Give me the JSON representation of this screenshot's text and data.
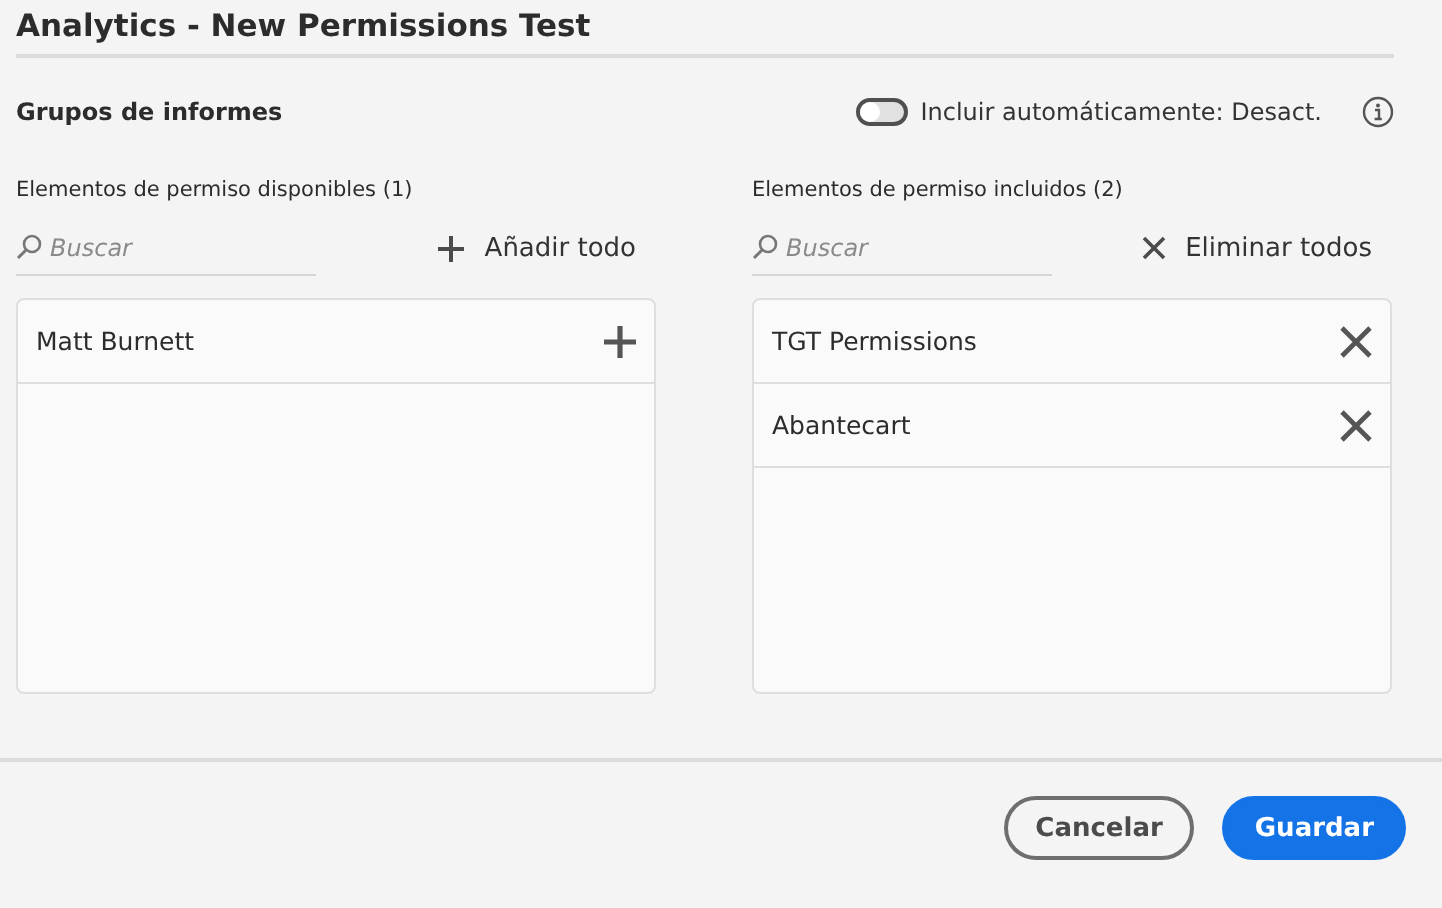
{
  "window": {
    "title": "Analytics - New Permissions Test"
  },
  "section": {
    "title": "Grupos de informes",
    "toggle": {
      "label": "Incluir automáticamente: Desact.",
      "on": false
    }
  },
  "panels": [
    {
      "label": "Elementos de permiso disponibles (1)",
      "kind": "add",
      "search": {
        "placeholder": "Buscar"
      },
      "action": "Añadir todo",
      "items": [
        "Matt Burnett"
      ]
    },
    {
      "label": "Elementos de permiso incluidos (2)",
      "kind": "remove",
      "search": {
        "placeholder": "Buscar"
      },
      "action": "Eliminar todos",
      "items": [
        "TGT Permissions",
        "Abantecart"
      ]
    }
  ],
  "buttons": [
    {
      "label": "Cancelar",
      "kind": "secondary"
    },
    {
      "label": "Guardar",
      "kind": "primary"
    }
  ]
}
